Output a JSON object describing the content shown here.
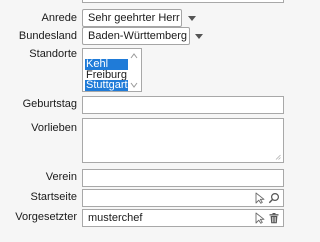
{
  "form": {
    "anrede": {
      "label": "Anrede",
      "value": "Sehr geehrter Herr"
    },
    "bundesland": {
      "label": "Bundesland",
      "value": "Baden-Württemberg"
    },
    "standorte": {
      "label": "Standorte",
      "options": [
        {
          "label": "Kehl",
          "selected": true
        },
        {
          "label": "Freiburg",
          "selected": false
        },
        {
          "label": "Stuttgart",
          "selected": true
        }
      ]
    },
    "geburtstag": {
      "label": "Geburtstag",
      "value": ""
    },
    "vorlieben": {
      "label": "Vorlieben",
      "value": ""
    },
    "verein": {
      "label": "Verein",
      "value": ""
    },
    "startseite": {
      "label": "Startseite",
      "value": ""
    },
    "vorgesetzter": {
      "label": "Vorgesetzter",
      "value": "musterchef"
    }
  },
  "icons": {
    "select": "cursor-arrow-icon",
    "search": "magnifier-icon",
    "delete": "trash-icon",
    "dropdown": "caret-down-icon",
    "resize": "resize-grip-icon"
  },
  "colors": {
    "selection": "#1f7bd8",
    "border": "#a8a8a8",
    "background": "#f6f6f6"
  }
}
